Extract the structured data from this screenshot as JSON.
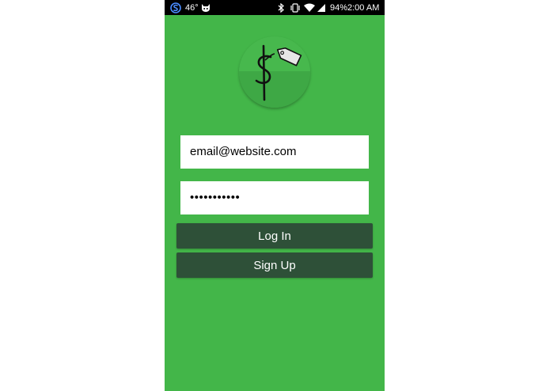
{
  "status_bar": {
    "temperature": "46°",
    "battery": "94%",
    "time": "2:00 AM",
    "icons": [
      "s-app-icon",
      "cat-icon",
      "bluetooth-icon",
      "vibrate-icon",
      "wifi-icon",
      "signal-icon",
      "battery-icon"
    ]
  },
  "logo": {
    "icon": "dollar-price-tag-icon",
    "glyph": "$",
    "circle_color": "#3ea845",
    "tag_color": "#e6e6e6"
  },
  "login_form": {
    "email_value": "email@website.com",
    "password_value": "•••••••••••",
    "login_label": "Log In",
    "signup_label": "Sign Up"
  },
  "colors": {
    "background": "#43b649",
    "button": "#2e5038",
    "status_bar": "#000000"
  }
}
